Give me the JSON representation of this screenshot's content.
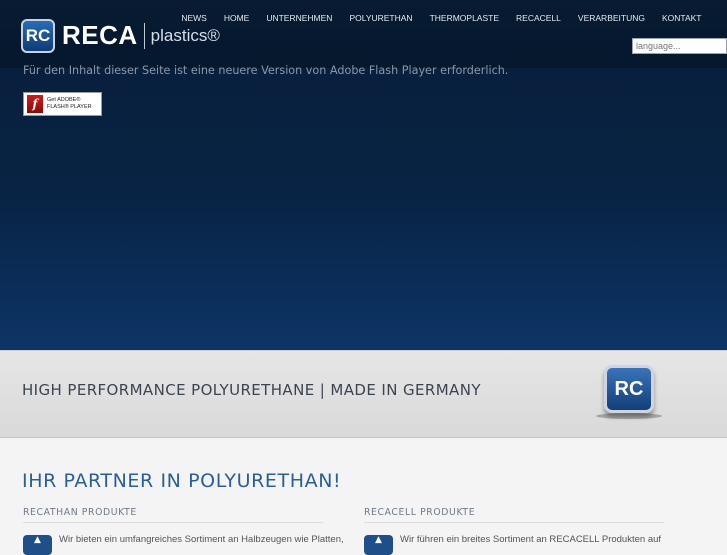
{
  "header": {
    "logo": {
      "badge": "RC",
      "name": "RECA",
      "sub": "plastics®"
    },
    "nav": [
      "NEWS",
      "HOME",
      "UNTERNEHMEN",
      "POLYURETHAN",
      "THERMOPLASTE",
      "RECACELL",
      "VERARBEITUNG",
      "KONTAKT"
    ],
    "language_placeholder": "language..."
  },
  "hero": {
    "flash_message": "Für den Inhalt dieser Seite ist eine neuere Version von Adobe Flash Player erforderlich.",
    "flash_button": {
      "icon_glyph": "f",
      "line1": "Get ADOBE®",
      "line2": "FLASH® PLAYER"
    }
  },
  "banner": {
    "text": "HIGH PERFORMANCE POLYURETHANE | MADE IN GERMANY",
    "badge": "RC"
  },
  "main": {
    "headline": "IHR PARTNER IN POLYURETHAN!",
    "columns": [
      {
        "title": "RECATHAN PRODUKTE",
        "text": "Wir bieten ein umfangreiches Sortiment an Halbzeugen wie Platten,"
      },
      {
        "title": "RECACELL PRODUKTE",
        "text": "Wir führen ein breites Sortiment an RECACELL Produkten auf"
      }
    ]
  },
  "colors": {
    "brand_blue": "#1f4f8a",
    "headline_blue": "#2b5f9b",
    "hero_dark": "#082344"
  }
}
